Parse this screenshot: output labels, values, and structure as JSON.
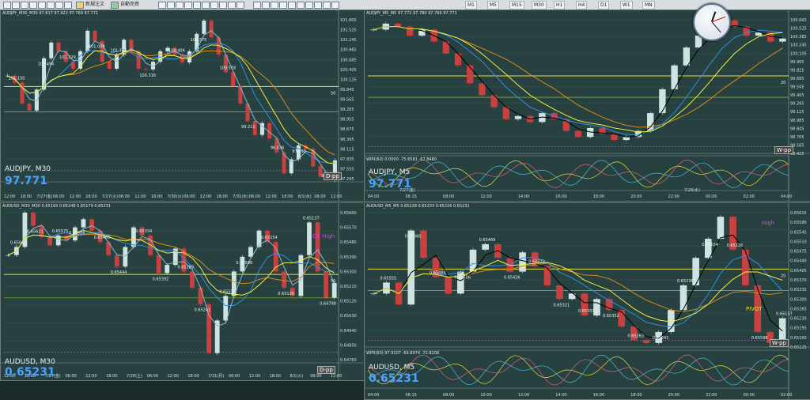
{
  "toolbar": {
    "new_order_label": "新規注文",
    "auto_trade_label": "自動売買",
    "timeframes": [
      "M1",
      "M5",
      "M15",
      "M30",
      "H1",
      "H4",
      "D1",
      "W1",
      "MN"
    ]
  },
  "colors": {
    "bg": "#274040",
    "bull": "#cfe3e3",
    "bear": "#c94040",
    "ma_orange": "#d98a1a",
    "ma_blue": "#2f8fe0",
    "ma_black": "#000000",
    "ma_yellow": "#f0f040",
    "ma_green": "#a0e020",
    "level_yellow": "#e0e040"
  },
  "charts": [
    {
      "id": "audjpy-m30",
      "header": "AUDJPY_M30_M30  97.817 97.922 97.769 97.771",
      "symbol": "AUDJPY, M30",
      "price": "97.771",
      "y_ticks": [
        "101.805",
        "101.525",
        "101.245",
        "100.965",
        "100.685",
        "100.405",
        "100.125",
        "99.845",
        "99.565",
        "99.285",
        "98.955",
        "98.675",
        "98.395",
        "98.115",
        "97.835",
        "97.555",
        "97.245"
      ],
      "x_ticks": [
        "12:00",
        "18:00",
        "7/27(金)",
        "06:00",
        "12:00",
        "18:00",
        "7/27(火)",
        "06:00",
        "12:00",
        "18:00",
        "7/30(火)",
        "06:00",
        "12:00",
        "18:00",
        "7/31(水)",
        "06:00",
        "12:00",
        "18:00",
        "8/1(水)",
        "06:00",
        "12:00"
      ],
      "annotations": [
        "101.150",
        "101.494",
        "101.229",
        "101.009",
        "101.778",
        "100.316",
        "100.406",
        "100.375",
        "100.578",
        "99.211",
        "98.836",
        "97.395",
        "97.193"
      ],
      "pp_label": "D-pp",
      "level_tag": "50",
      "chart_data": {
        "type": "line",
        "title": "AUDJPY, M30",
        "ylim": [
          97.245,
          101.805
        ],
        "series": [
          {
            "name": "close",
            "values": [
              100.2,
              100.0,
              99.4,
              99.2,
              99.8,
              100.7,
              101.15,
              100.9,
              100.6,
              100.4,
              100.9,
              101.49,
              101.2,
              100.6,
              100.4,
              100.8,
              101.23,
              100.9,
              100.4,
              100.38,
              100.6,
              100.9,
              101.0,
              100.8,
              100.58,
              100.9,
              101.4,
              101.78,
              101.3,
              100.8,
              100.3,
              99.9,
              99.4,
              98.9,
              98.5,
              98.84,
              98.4,
              98.0,
              97.4,
              97.8,
              98.2,
              98.1,
              97.6,
              97.3,
              97.2,
              97.77
            ]
          }
        ]
      }
    },
    {
      "id": "audjpy-m5",
      "header": "AUDJPY_M5_M5  97.772 97.780 97.769 97.771",
      "symbol": "AUDJPY, M5",
      "price": "97.771",
      "osc_label": "WPR(60)  0.0000  -75.6581  -67.8480",
      "y_ticks": [
        "100.665",
        "100.525",
        "100.385",
        "100.245",
        "100.105",
        "99.965",
        "99.825",
        "99.685",
        "99.545",
        "99.405",
        "99.265",
        "99.125",
        "98.985",
        "98.845",
        "98.705",
        "98.565",
        "98.425"
      ],
      "x_ticks": [
        "04:00",
        "06:15",
        "08:00",
        "12:00",
        "14:00",
        "16:00",
        "18:00",
        "20:00",
        "22:00",
        "00:00",
        "02:00",
        "04:00"
      ],
      "date_labels": [
        "7/27(金)",
        "7/28(水)"
      ],
      "pp_label": "W-pp",
      "level_tag": "20",
      "chart_data": {
        "type": "line",
        "title": "AUDJPY, M5",
        "ylim": [
          98.425,
          100.665
        ],
        "series": [
          {
            "name": "close",
            "values": [
              100.5,
              100.6,
              100.55,
              100.4,
              100.5,
              100.3,
              100.1,
              99.9,
              99.6,
              99.4,
              99.2,
              99.0,
              99.05,
              98.95,
              99.1,
              99.0,
              98.8,
              98.7,
              98.85,
              98.75,
              98.65,
              98.7,
              98.8,
              99.1,
              99.5,
              99.9,
              100.2,
              100.4,
              100.5,
              100.65,
              100.55,
              100.4,
              100.45,
              100.3,
              100.35
            ]
          }
        ]
      }
    },
    {
      "id": "audusd-m30",
      "header": "AUDUSD_M30_M30  0.65193 0.65248 0.65179 0.65231",
      "symbol": "AUDUSD, M30",
      "price": "0.65231",
      "y_ticks": [
        "0.65660",
        "0.65570",
        "0.65480",
        "0.65390",
        "0.65300",
        "0.65210",
        "0.65120",
        "0.65030",
        "0.64940",
        "0.64850",
        "0.64760"
      ],
      "x_ticks": [
        "12:00",
        "18:00",
        "7/27(金)",
        "06:00",
        "12:00",
        "18:00",
        "7/28(土)",
        "06:00",
        "12:00",
        "18:00",
        "7/31(月)",
        "06:00",
        "12:00",
        "18:00",
        "8/1(火)",
        "06:00",
        "12:00"
      ],
      "annotations": [
        "0.65663",
        "0.65621",
        "0.65575",
        "0.65506",
        "0.65465",
        "0.65444",
        "0.65334",
        "0.65392",
        "0.65289",
        "0.65241",
        "0.65555",
        "0.65598",
        "0.65154",
        "0.65136",
        "0.65137",
        "0.64798"
      ],
      "pp_label": "D-pp",
      "high_label": "D1 High",
      "level_tag": "50",
      "chart_data": {
        "type": "line",
        "title": "AUDUSD, M30",
        "ylim": [
          0.6476,
          0.6566
        ],
        "series": [
          {
            "name": "close",
            "values": [
              0.654,
              0.6545,
              0.6566,
              0.6558,
              0.6551,
              0.6546,
              0.6552,
              0.6549,
              0.6557,
              0.6562,
              0.6555,
              0.6548,
              0.654,
              0.6533,
              0.6545,
              0.6557,
              0.6552,
              0.654,
              0.6529,
              0.6534,
              0.6544,
              0.653,
              0.652,
              0.651,
              0.648,
              0.65,
              0.6515,
              0.653,
              0.6539,
              0.6545,
              0.6555,
              0.6548,
              0.653,
              0.652,
              0.6515,
              0.654,
              0.656,
              0.653,
              0.6514,
              0.6523
            ]
          }
        ]
      }
    },
    {
      "id": "audusd-m5",
      "header": "AUDUSD_M5_M5  0.65228 0.65233 0.65226 0.65231",
      "symbol": "AUDUSD, M5",
      "price": "0.65231",
      "osc_label": "WPR(60)  97.9107  -69.8974  -72.8208",
      "y_ticks": [
        "0.65615",
        "0.65580",
        "0.65545",
        "0.65510",
        "0.65475",
        "0.65440",
        "0.65405",
        "0.65370",
        "0.65335",
        "0.65300",
        "0.65265",
        "0.65230",
        "0.65195",
        "0.65160",
        "0.65125"
      ],
      "x_ticks": [
        "04:00",
        "06:15",
        "08:00",
        "10:00",
        "12:00",
        "14:00",
        "16:00",
        "18:00",
        "20:00",
        "22:00",
        "00:00",
        "02:00"
      ],
      "annotations": [
        "0.65555",
        "0.65360",
        "0.65484",
        "0.65506",
        "0.65469",
        "0.65426",
        "0.65372",
        "0.65321",
        "0.65337",
        "0.65352",
        "0.65263",
        "0.65241",
        "0.65236",
        "0.65154",
        "0.65136",
        "0.65598",
        "0.65137"
      ],
      "pp_label": "W-pp",
      "high_label": "High",
      "pivot_label": "PIVOT",
      "level_tag": "20",
      "chart_data": {
        "type": "line",
        "title": "AUDUSD, M5",
        "ylim": [
          0.65125,
          0.65615
        ],
        "series": [
          {
            "name": "close",
            "values": [
              0.6532,
              0.6536,
              0.6528,
              0.6555,
              0.6545,
              0.6538,
              0.6532,
              0.654,
              0.6548,
              0.655,
              0.6545,
              0.654,
              0.6547,
              0.6542,
              0.6535,
              0.653,
              0.6532,
              0.6524,
              0.653,
              0.6526,
              0.652,
              0.6515,
              0.6514,
              0.6518,
              0.6526,
              0.6535,
              0.6545,
              0.6552,
              0.656,
              0.6548,
              0.6535,
              0.6518,
              0.6514,
              0.6523
            ]
          }
        ]
      }
    }
  ]
}
